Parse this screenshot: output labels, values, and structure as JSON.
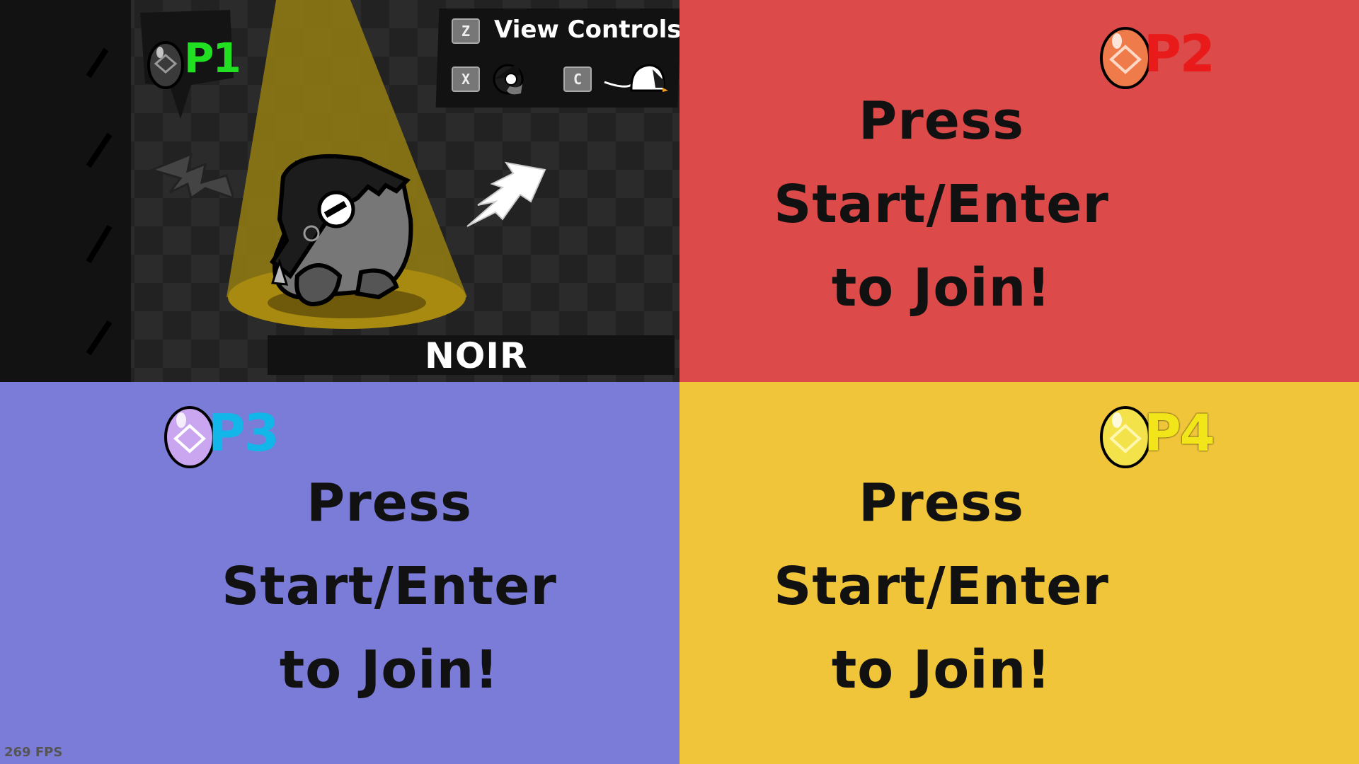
{
  "players": [
    {
      "id": "p1",
      "badge": "P1",
      "color": "#21e021",
      "egg": "#444444",
      "character_name": "NOIR"
    },
    {
      "id": "p2",
      "badge": "P2",
      "color": "#e81a1a",
      "bg": "#dc4a4a",
      "egg": "#ef7a4a",
      "join_line1": "Press Start/Enter",
      "join_line2": "to Join!"
    },
    {
      "id": "p3",
      "badge": "P3",
      "color": "#12b6e8",
      "bg": "#7b7bd8",
      "egg": "#c9a6ef",
      "join_line1": "Press Start/Enter",
      "join_line2": "to Join!"
    },
    {
      "id": "p4",
      "badge": "P4",
      "color": "#f2e61a",
      "bg": "#f0c53a",
      "egg": "#f4e24a",
      "join_line1": "Press Start/Enter",
      "join_line2": "to Join!"
    }
  ],
  "controls": {
    "view_key": "Z",
    "view_label": "View Controls",
    "prev_key": "X",
    "next_key": "C",
    "prev_icon": "noir-head-icon",
    "next_icon": "white-cap-icon"
  },
  "arrows": {
    "left": "lightning-left-arrow-icon",
    "right": "lightning-right-arrow-icon"
  },
  "fps": "269 FPS"
}
